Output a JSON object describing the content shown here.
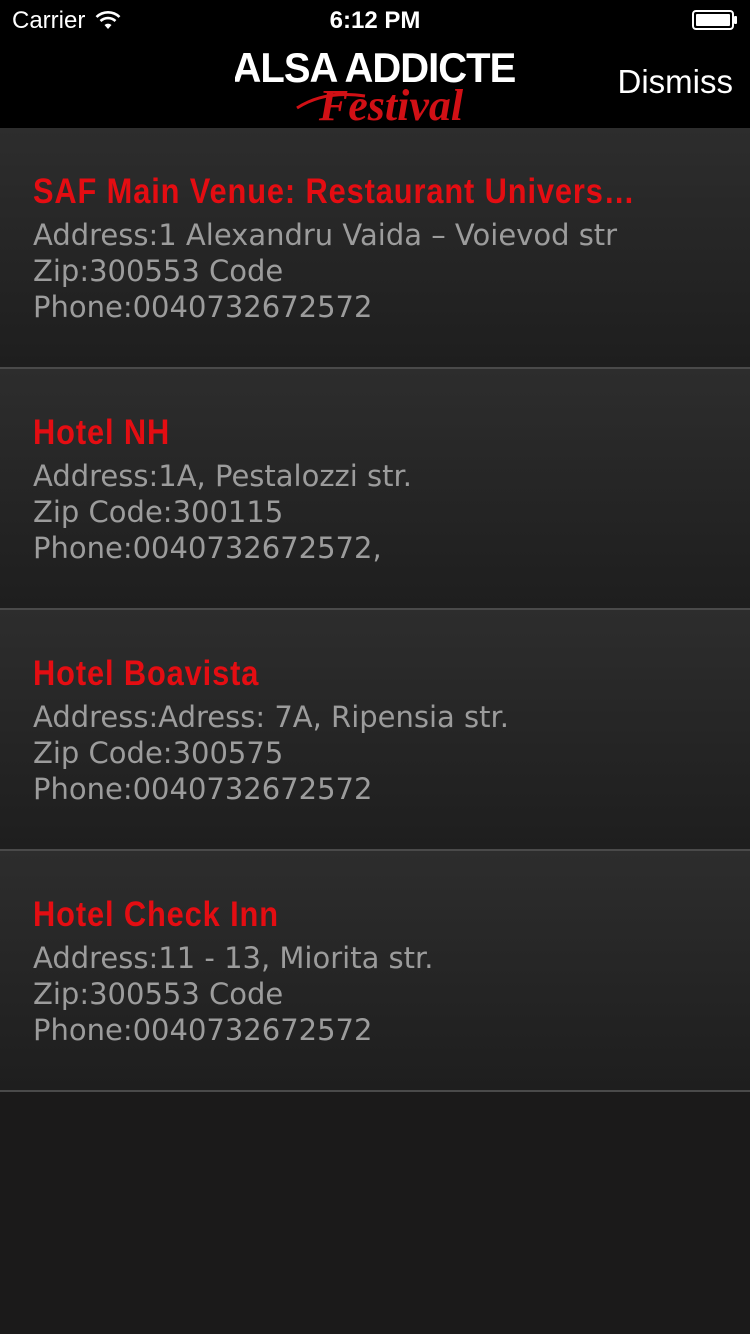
{
  "status_bar": {
    "carrier": "Carrier",
    "time": "6:12 PM",
    "wifi_icon": "wifi-icon",
    "battery_icon": "battery-icon"
  },
  "nav": {
    "logo_line1": "SALSA ADDICTED",
    "logo_line2": "Festival",
    "dismiss_label": "Dismiss"
  },
  "colors": {
    "title_red": "#e40d12",
    "text_gray": "#9c9c9c",
    "background": "#1b1a1a"
  },
  "venues": [
    {
      "title": "SAF Main Venue: Restaurant Universit...",
      "address": "Address:1 Alexandru Vaida – Voievod str",
      "zip": "Zip:300553 Code",
      "phone": "Phone:0040732672572"
    },
    {
      "title": "Hotel NH",
      "address": "Address:1A, Pestalozzi str.",
      "zip": "Zip Code:300115",
      "phone": "Phone:0040732672572,"
    },
    {
      "title": "Hotel Boavista",
      "address": "Address:Adress: 7A, Ripensia str.",
      "zip": "Zip Code:300575",
      "phone": "Phone:0040732672572"
    },
    {
      "title": "Hotel Check Inn",
      "address": "Address:11 - 13, Miorita str.",
      "zip": "Zip:300553 Code",
      "phone": "Phone:0040732672572"
    }
  ]
}
